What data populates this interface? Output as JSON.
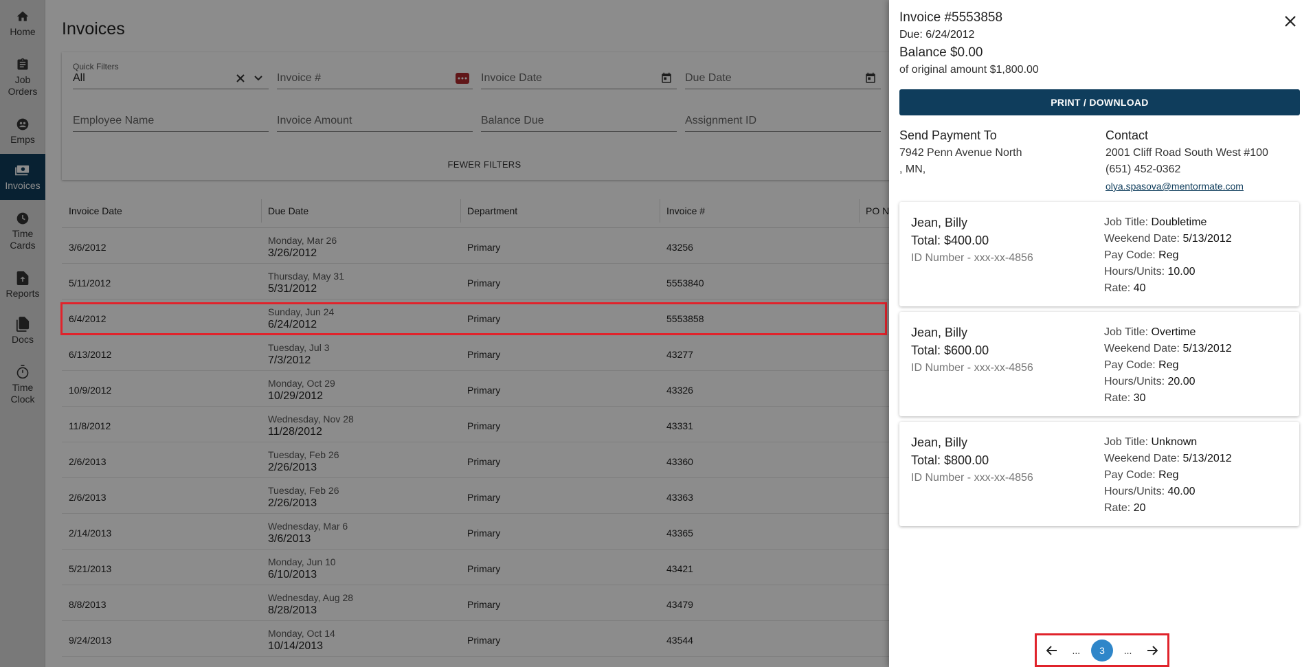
{
  "nav": {
    "items": [
      {
        "label": "Home",
        "icon": "home-icon"
      },
      {
        "label": "Job Orders",
        "icon": "clipboard-icon"
      },
      {
        "label": "Emps",
        "icon": "people-icon"
      },
      {
        "label": "Invoices",
        "icon": "money-icon"
      },
      {
        "label": "Time Cards",
        "icon": "clock-icon"
      },
      {
        "label": "Reports",
        "icon": "upload-document-icon"
      },
      {
        "label": "Docs",
        "icon": "documents-icon"
      },
      {
        "label": "Time Clock",
        "icon": "stopwatch-icon"
      }
    ],
    "active": "Invoices"
  },
  "page": {
    "title": "Invoices"
  },
  "filters": {
    "quick_filters_label": "Quick Filters",
    "quick_filters_value": "All",
    "invoice_number_placeholder": "Invoice #",
    "invoice_date_placeholder": "Invoice Date",
    "due_date_placeholder": "Due Date",
    "employee_name_placeholder": "Employee Name",
    "invoice_amount_placeholder": "Invoice Amount",
    "balance_due_placeholder": "Balance Due",
    "assignment_id_placeholder": "Assignment ID",
    "fewer_filters_label": "FEWER FILTERS"
  },
  "table": {
    "columns": [
      "Invoice Date",
      "Due Date",
      "Department",
      "Invoice #",
      "PO N"
    ],
    "rows": [
      {
        "invoice_date": "3/6/2012",
        "due_day": "Monday, Mar 26",
        "due_date": "3/26/2012",
        "department": "Primary",
        "invoice_no": "43256"
      },
      {
        "invoice_date": "5/11/2012",
        "due_day": "Thursday, May 31",
        "due_date": "5/31/2012",
        "department": "Primary",
        "invoice_no": "5553840"
      },
      {
        "invoice_date": "6/4/2012",
        "due_day": "Sunday, Jun 24",
        "due_date": "6/24/2012",
        "department": "Primary",
        "invoice_no": "5553858"
      },
      {
        "invoice_date": "6/13/2012",
        "due_day": "Tuesday, Jul 3",
        "due_date": "7/3/2012",
        "department": "Primary",
        "invoice_no": "43277"
      },
      {
        "invoice_date": "10/9/2012",
        "due_day": "Monday, Oct 29",
        "due_date": "10/29/2012",
        "department": "Primary",
        "invoice_no": "43326"
      },
      {
        "invoice_date": "11/8/2012",
        "due_day": "Wednesday, Nov 28",
        "due_date": "11/28/2012",
        "department": "Primary",
        "invoice_no": "43331"
      },
      {
        "invoice_date": "2/6/2013",
        "due_day": "Tuesday, Feb 26",
        "due_date": "2/26/2013",
        "department": "Primary",
        "invoice_no": "43360"
      },
      {
        "invoice_date": "2/6/2013",
        "due_day": "Tuesday, Feb 26",
        "due_date": "2/26/2013",
        "department": "Primary",
        "invoice_no": "43363"
      },
      {
        "invoice_date": "2/14/2013",
        "due_day": "Wednesday, Mar 6",
        "due_date": "3/6/2013",
        "department": "Primary",
        "invoice_no": "43365"
      },
      {
        "invoice_date": "5/21/2013",
        "due_day": "Monday, Jun 10",
        "due_date": "6/10/2013",
        "department": "Primary",
        "invoice_no": "43421"
      },
      {
        "invoice_date": "8/8/2013",
        "due_day": "Wednesday, Aug 28",
        "due_date": "8/28/2013",
        "department": "Primary",
        "invoice_no": "43479"
      },
      {
        "invoice_date": "9/24/2013",
        "due_day": "Monday, Oct 14",
        "due_date": "10/14/2013",
        "department": "Primary",
        "invoice_no": "43544"
      }
    ]
  },
  "drawer": {
    "title": "Invoice #5553858",
    "due": "Due: 6/24/2012",
    "balance": "Balance $0.00",
    "original": "of original amount $1,800.00",
    "print_label": "PRINT / DOWNLOAD",
    "send_payment_heading": "Send Payment To",
    "send_payment_line1": "7942 Penn Avenue North",
    "send_payment_line2": ", MN,",
    "contact_heading": "Contact",
    "contact_address": "2001 Cliff Road South West #100",
    "contact_phone": "(651) 452-0362",
    "contact_email": "olya.spasova@mentormate.com",
    "cards": [
      {
        "name": "Jean, Billy",
        "total": "Total: $400.00",
        "id_number": "ID Number - xxx-xx-4856",
        "job_title": "Doubletime",
        "weekend_date": "5/13/2012",
        "pay_code": "Reg",
        "hours_units": "10.00",
        "rate": "40"
      },
      {
        "name": "Jean, Billy",
        "total": "Total: $600.00",
        "id_number": "ID Number - xxx-xx-4856",
        "job_title": "Overtime",
        "weekend_date": "5/13/2012",
        "pay_code": "Reg",
        "hours_units": "20.00",
        "rate": "30"
      },
      {
        "name": "Jean, Billy",
        "total": "Total: $800.00",
        "id_number": "ID Number - xxx-xx-4856",
        "job_title": "Unknown",
        "weekend_date": "5/13/2012",
        "pay_code": "Reg",
        "hours_units": "40.00",
        "rate": "20"
      }
    ],
    "detail_labels": {
      "job_title": "Job Title: ",
      "weekend_date": "Weekend Date: ",
      "pay_code": "Pay Code: ",
      "hours_units": "Hours/Units: ",
      "rate": "Rate: "
    },
    "pager": {
      "ellipsis": "...",
      "current_page": "3"
    }
  },
  "colors": {
    "primary": "#0f3d5c",
    "accent": "#2f86c9",
    "highlight": "#e0232b"
  }
}
